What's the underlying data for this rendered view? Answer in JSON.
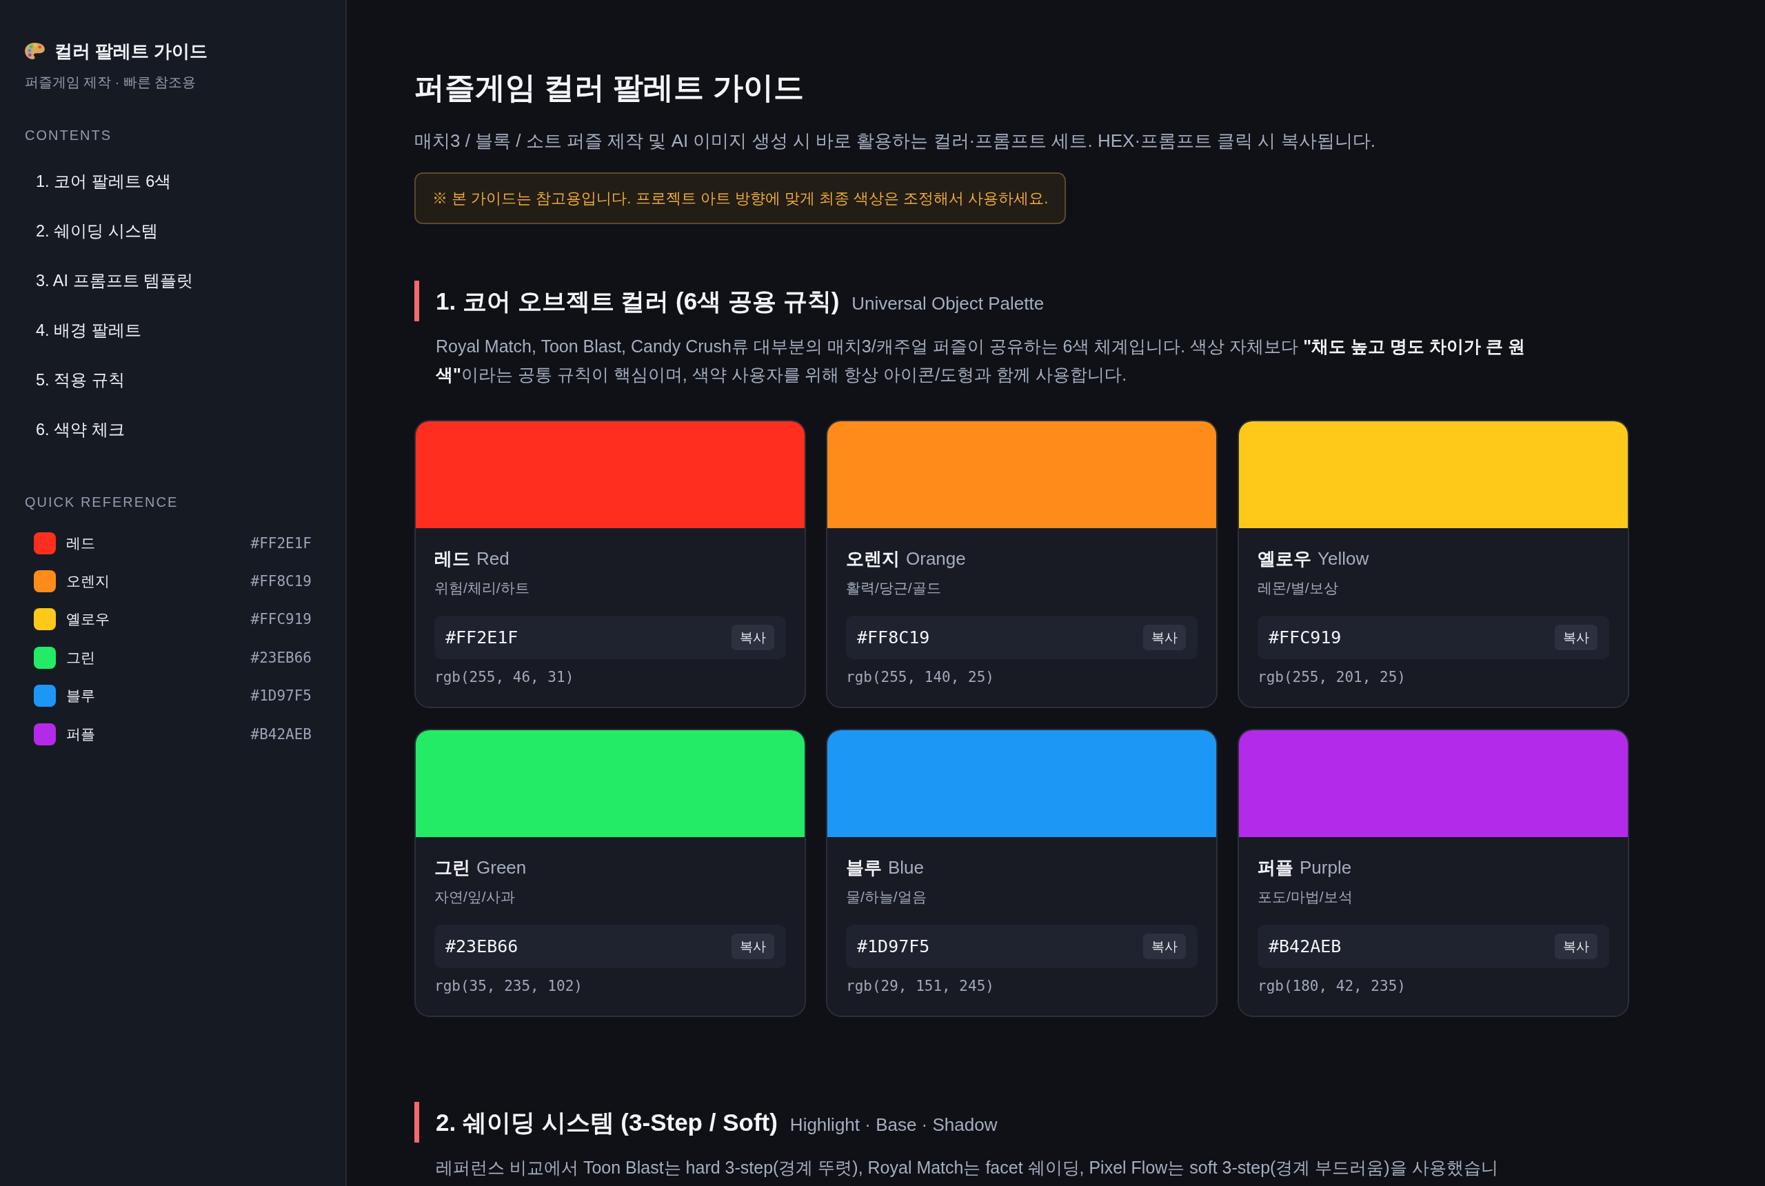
{
  "sidebar": {
    "title": "컬러 팔레트 가이드",
    "subtitle": "퍼즐게임 제작 · 빠른 참조용",
    "contents_heading": "CONTENTS",
    "contents": [
      "1. 코어 팔레트 6색",
      "2. 쉐이딩 시스템",
      "3. AI 프롬프트 템플릿",
      "4. 배경 팔레트",
      "5. 적용 규칙",
      "6. 색약 체크"
    ],
    "quick_reference_heading": "QUICK REFERENCE",
    "quick_reference": [
      {
        "name": "레드",
        "hex": "#FF2E1F",
        "color": "#ff2e1f"
      },
      {
        "name": "오렌지",
        "hex": "#FF8C19",
        "color": "#ff8c19"
      },
      {
        "name": "옐로우",
        "hex": "#FFC919",
        "color": "#ffc919"
      },
      {
        "name": "그린",
        "hex": "#23EB66",
        "color": "#23eb66"
      },
      {
        "name": "블루",
        "hex": "#1D97F5",
        "color": "#1d97f5"
      },
      {
        "name": "퍼플",
        "hex": "#B42AEB",
        "color": "#b42aeb"
      }
    ]
  },
  "main": {
    "title": "퍼즐게임 컬러 팔레트 가이드",
    "intro": "매치3 / 블록 / 소트 퍼즐 제작 및 AI 이미지 생성 시 바로 활용하는 컬러·프롬프트 세트. HEX·프롬프트 클릭 시 복사됩니다.",
    "note": "※ 본 가이드는 참고용입니다. 프로젝트 아트 방향에 맞게 최종 색상은 조정해서 사용하세요.",
    "sections": [
      {
        "heading": "1. 코어 오브젝트 컬러 (6색 공용 규칙)",
        "subheading": "Universal Object Palette",
        "paragraph": "Royal Match, Toon Blast, Candy Crush류 대부분의 매치3/캐주얼 퍼즐이 공유하는 6색 체계입니다. 색상 자체보다 **\"채도 높고 명도 차이가 큰 원색\"**이라는 공통 규칙이 핵심이며, 색약 사용자를 위해 항상 아이콘/도형과 함께 사용합니다.",
        "cards": [
          {
            "name_ko": "레드",
            "name_en": "Red",
            "usage": "위험/체리/하트",
            "hex": "#FF2E1F",
            "copy_label": "복사",
            "rgb": "rgb(255, 46, 31)",
            "color": "#ff2e1f"
          },
          {
            "name_ko": "오렌지",
            "name_en": "Orange",
            "usage": "활력/당근/골드",
            "hex": "#FF8C19",
            "copy_label": "복사",
            "rgb": "rgb(255, 140, 25)",
            "color": "#ff8c19"
          },
          {
            "name_ko": "옐로우",
            "name_en": "Yellow",
            "usage": "레몬/별/보상",
            "hex": "#FFC919",
            "copy_label": "복사",
            "rgb": "rgb(255, 201, 25)",
            "color": "#ffc919"
          },
          {
            "name_ko": "그린",
            "name_en": "Green",
            "usage": "자연/잎/사과",
            "hex": "#23EB66",
            "copy_label": "복사",
            "rgb": "rgb(35, 235, 102)",
            "color": "#23eb66"
          },
          {
            "name_ko": "블루",
            "name_en": "Blue",
            "usage": "물/하늘/얼음",
            "hex": "#1D97F5",
            "copy_label": "복사",
            "rgb": "rgb(29, 151, 245)",
            "color": "#1d97f5"
          },
          {
            "name_ko": "퍼플",
            "name_en": "Purple",
            "usage": "포도/마법/보석",
            "hex": "#B42AEB",
            "copy_label": "복사",
            "rgb": "rgb(180, 42, 235)",
            "color": "#b42aeb"
          }
        ]
      },
      {
        "heading": "2. 쉐이딩 시스템 (3-Step / Soft)",
        "subheading": "Highlight · Base · Shadow",
        "paragraph": "레퍼런스 비교에서 Toon Blast는 hard 3-step(경계 뚜렷), Royal Match는 facet 쉐이딩, Pixel Flow는 soft 3-step(경계 부드러움)을 사용했습니"
      }
    ]
  }
}
